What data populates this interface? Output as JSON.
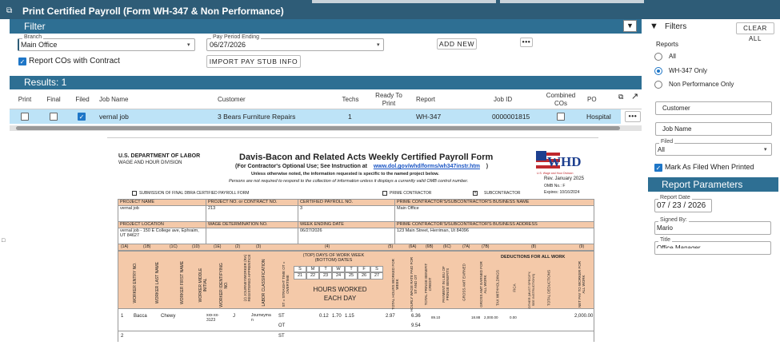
{
  "window": {
    "title": "Print Certified Payroll (Form WH-347 & Non Performance)"
  },
  "filter": {
    "title": "Filter",
    "branch_label": "Branch",
    "branch_value": "Main Office",
    "pay_period_label": "Pay Period Ending",
    "pay_period_value": "06/27/2026",
    "add_new": "ADD NEW",
    "import_btn": "IMPORT PAY STUB INFO",
    "report_cos_label": "Report COs with Contract",
    "report_cos_checked": true
  },
  "results": {
    "title": "Results: 1",
    "columns": [
      "Print",
      "Final",
      "Filed",
      "Job Name",
      "Customer",
      "Techs",
      "Ready To Print",
      "Report",
      "Job ID",
      "Combined COs",
      "PO"
    ],
    "rows": [
      {
        "job_name": "vernal job",
        "customer": "3 Bears Furniture Repairs",
        "techs": "1",
        "report": "WH-347",
        "job_id": "0000001815",
        "po": "Hospital"
      }
    ]
  },
  "form": {
    "dept": "U.S. DEPARTMENT OF LABOR",
    "division": "WAGE AND HOUR DIVISION",
    "title": "Davis-Bacon and Related Acts Weekly Certified Payroll Form",
    "subtitle_a": "(For Contractor's Optional Use; See Instruction at",
    "subtitle_link": "www.dol.gov/whd/forms/wh347instr.htm",
    "subtitle_b": ")",
    "line2": "Unless otherwise noted, the information requested is specific to the named project below.",
    "line3": "Persons are not required to respond to the collection of information unless it displays a currently valid OMB control number.",
    "logo": "WHD",
    "logo_sub": "U.S. Wage and Hour Division",
    "rev": "Rev. January 2025",
    "omb": "OMB No.: F",
    "expires": "Expires: 10/16/2024",
    "opt_final": "SUBMISSION OF FINAL DBRA CERTIFIED PAYROLL FORM",
    "opt_prime": "PRIME CONTRACTOR",
    "opt_sub": "SUBCONTRACTOR",
    "project_name_h": "PROJECT NAME",
    "project_name": "vernal job",
    "project_no_h": "PROJECT NO. or CONTRACT NO.",
    "project_no": "213",
    "payroll_no_h": "CERTIFIED PAYROLL NO.",
    "payroll_no": "3",
    "business_name_h": "PRIME CONTRACTOR'S/SUBCONTRACTOR'S BUSINESS NAME",
    "business_name": "Main Office",
    "location_h": "PROJECT LOCATION",
    "location": "vernal job - 150 E College ave, Ephraim, UT 84627",
    "wage_det_h": "WAGE DETERMINATION NO.",
    "week_end_h": "WEEK ENDING DATE",
    "week_end": "06/27/2026",
    "business_addr_h": "PRIME CONTRACTOR'S/SUBCONTRACTOR'S BUSINESS ADDRESS",
    "business_addr": "123 Main Street, Herriman, Ut 84096",
    "col_nums": [
      "(1A)",
      "(1B)",
      "(1C)",
      "(1D)",
      "(1E)",
      "(2)",
      "(3)",
      "(4)",
      "(5)",
      "(6A)",
      "(6B)",
      "(6C)",
      "(7A)",
      "(7B)",
      "(8)",
      "(9)"
    ],
    "col_heads": [
      "WORKER ENTRY NO.",
      "WORKER LAST NAME",
      "WORKER FIRST NAME",
      "WORKER MIDDLE INITIAL",
      "WORKER IDENTIFYING NO.",
      "(J) JOURNEYWORKER (RA) REGISTERED APPRENTICE",
      "LABOR CLASSIFICATION",
      "ST = STRAIGHT TIME OT = OVERTIME",
      "TOTAL HOURS WORKED FOR WEEK",
      "HOURLY WAGE RATE PAID FOR ST AND OT",
      "TOTAL FRINGE BENEFIT CREDIT",
      "PAYMENT IN LIEU OF FRINGE BENEFITS",
      "GROSS AMT EARNED",
      "GROSS AMT EARNED FOR ALL WORK",
      "TAX WITHHOLDINGS",
      "FICA",
      "OTHER (MUST SPECIFY; SEE INSTRUCTIONS)",
      "TOTAL DEDUCTIONS",
      "NET PAY TO WORKER FOR ALL WORK"
    ],
    "days_h": "(TOP) DAYS OF WORK WEEK (BOTTOM) DATES",
    "days": [
      "S",
      "M",
      "T",
      "W",
      "T",
      "F",
      "S"
    ],
    "dates": [
      "21",
      "22",
      "23",
      "24",
      "25",
      "26",
      "27"
    ],
    "hours_h": "HOURS WORKED EACH DAY",
    "deductions_h": "DEDUCTIONS FOR ALL WORK",
    "worker": {
      "no": "1",
      "last": "Bacca",
      "first": "Chewy",
      "id": "xxx-xx-3123",
      "jr": "J",
      "class": "Journeyma n",
      "st": "ST",
      "ot": "OT",
      "hours": [
        "",
        "",
        "0.12",
        "1.70",
        "1.15",
        "",
        ""
      ],
      "total": "2.97",
      "rate_st": "6.36",
      "rate_ot": "9.54",
      "fringe": "89.10",
      "gross": "18.88",
      "gross_all": "2,000.00",
      "tax": "0.00",
      "net": "2,000.00"
    },
    "row2": "2",
    "row2_st": "ST"
  },
  "sidebar": {
    "filters_title": "Filters",
    "clear_all": "CLEAR ALL",
    "reports_label": "Reports",
    "options": [
      {
        "label": "All",
        "selected": false
      },
      {
        "label": "WH-347 Only",
        "selected": true
      },
      {
        "label": "Non Performance Only",
        "selected": false
      }
    ],
    "customer": "Customer",
    "job_name": "Job Name",
    "filed_label": "Filed",
    "filed_value": "All",
    "mark_filed": "Mark As Filed When Printed",
    "report_params": "Report Parameters",
    "report_date_label": "Report Date",
    "report_date": "07 / 23 / 2026",
    "signed_label": "Signed By:",
    "signed_value": "Mario",
    "title_label": "Title",
    "title_value": "Office Manager"
  },
  "colors": {
    "header": "#2e5c77",
    "bar": "#2e6f93",
    "row": "#bde3f7",
    "form_peach": "#f4c9a9",
    "accent": "#1e76c7"
  }
}
